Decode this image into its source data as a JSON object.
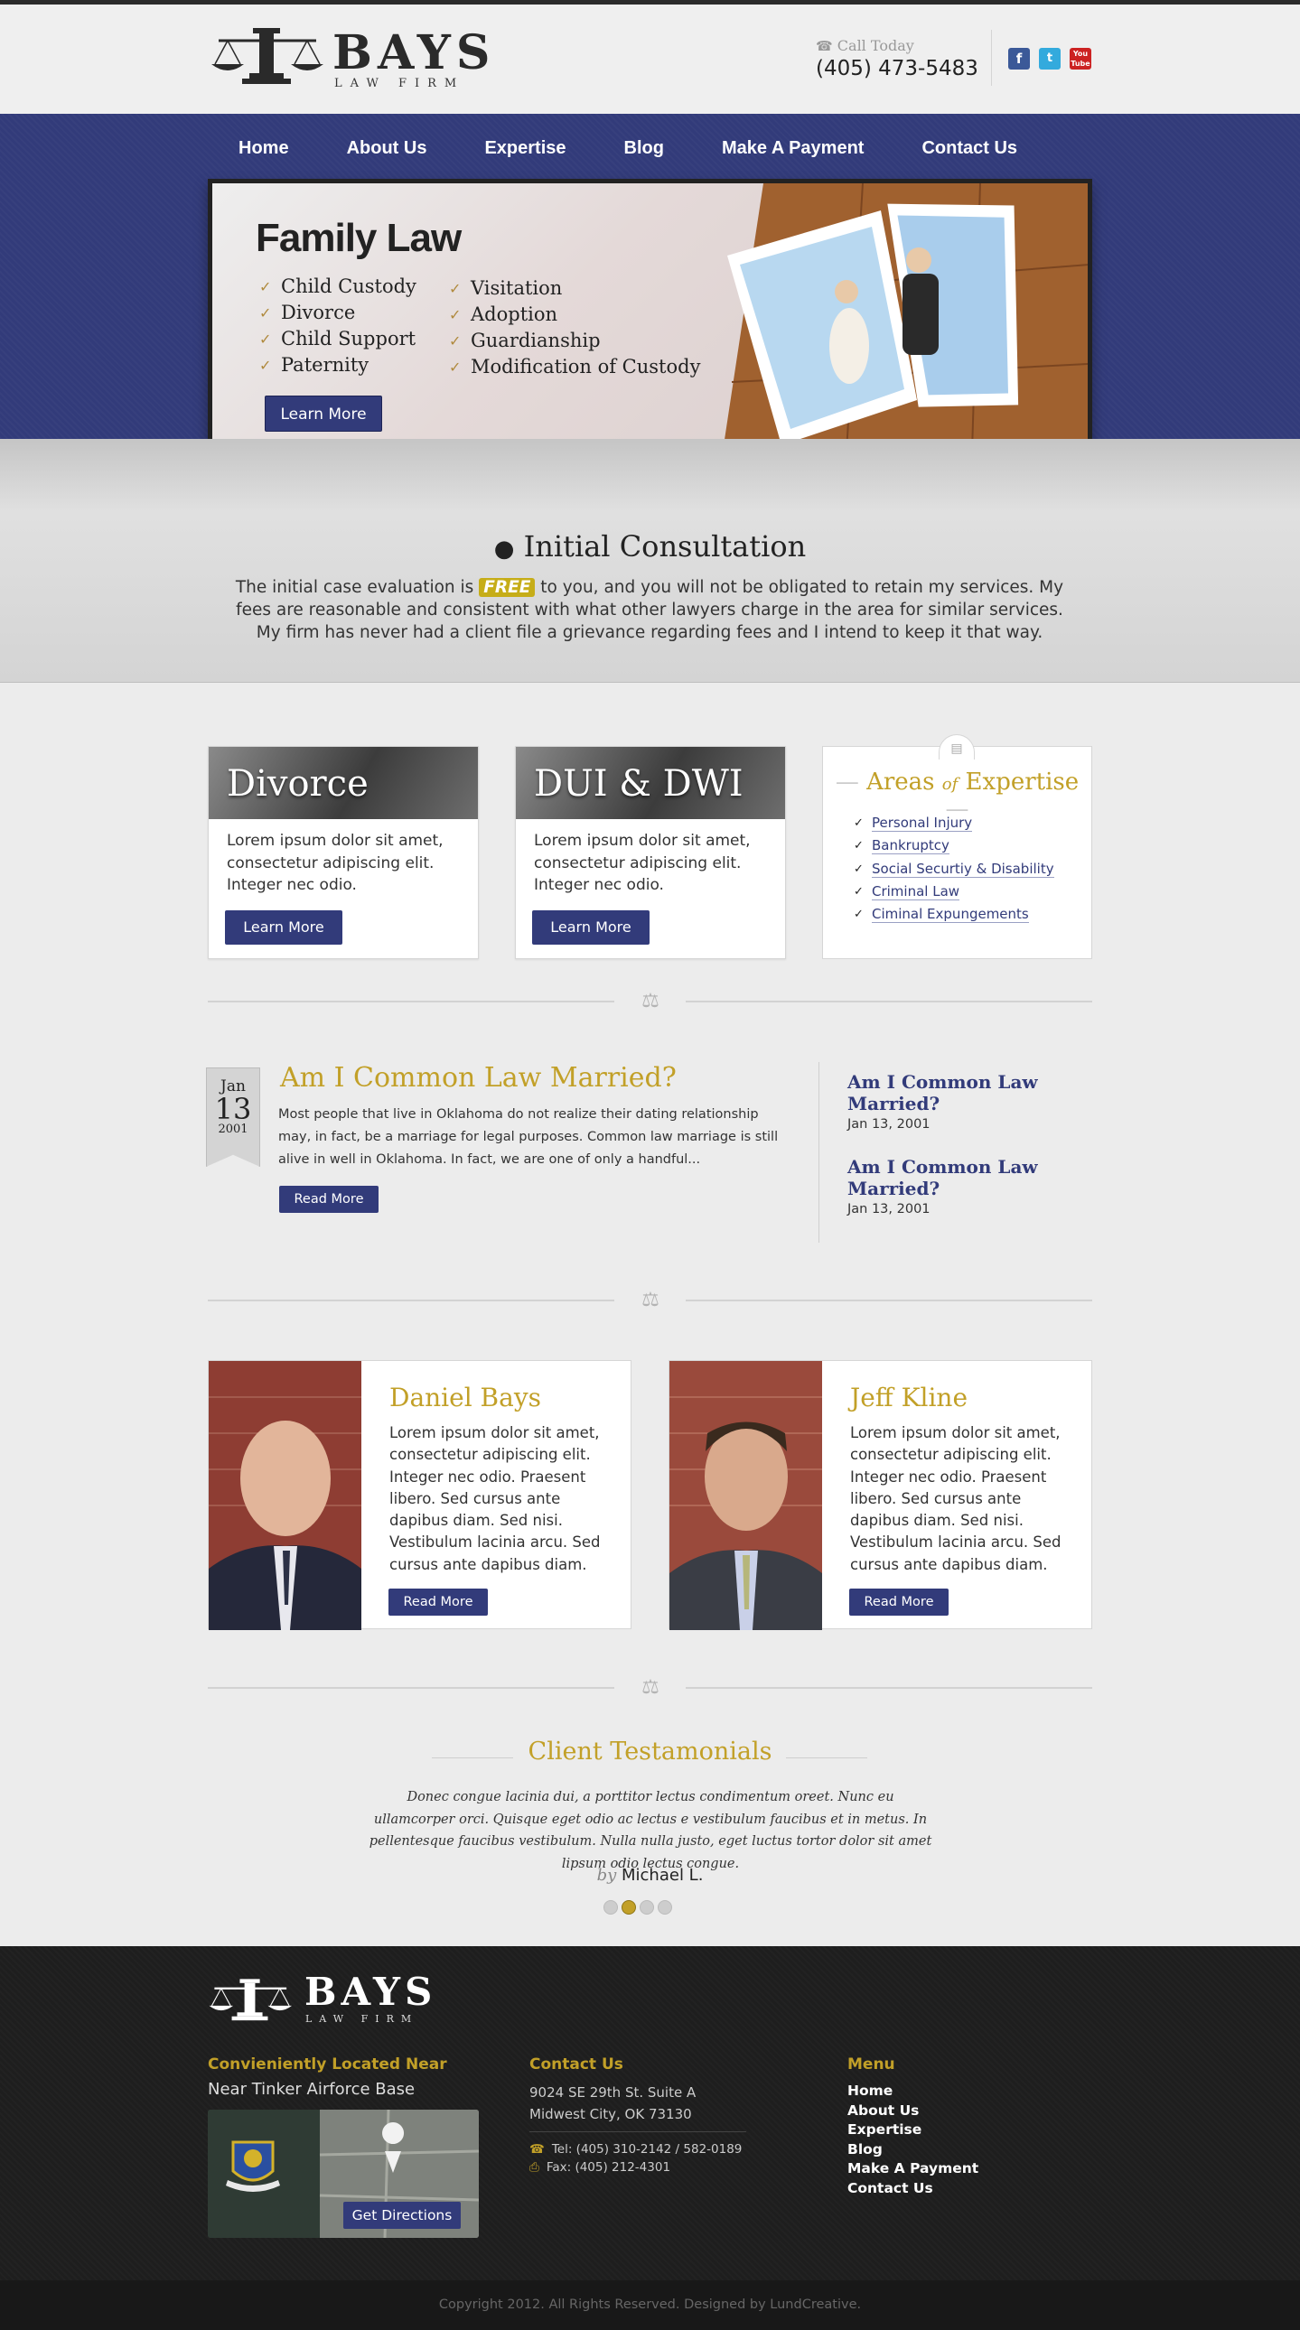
{
  "header": {
    "logo_name": "BAYS",
    "logo_sub": "LAW FIRM",
    "call_today": "Call Today",
    "phone": "(405) 473-5483",
    "social": [
      {
        "icon": "facebook-icon",
        "glyph": "f",
        "color": "#3b5998"
      },
      {
        "icon": "twitter-icon",
        "glyph": "t",
        "color": "#33aadd"
      },
      {
        "icon": "youtube-icon",
        "glyph": "You Tube",
        "color": "#cc2222"
      }
    ]
  },
  "nav": {
    "items": [
      "Home",
      "About Us",
      "Expertise",
      "Blog",
      "Make A Payment",
      "Contact Us"
    ]
  },
  "hero": {
    "title": "Family Law",
    "col1": [
      "Child Custody",
      "Divorce",
      "Child Support",
      "Paternity"
    ],
    "col2": [
      "Visitation",
      "Adoption",
      "Guardianship",
      "Modification of Custody"
    ],
    "button": "Learn More"
  },
  "consultation": {
    "title": "Initial Consultation",
    "text_before": "The initial case evaluation is ",
    "free": "FREE",
    "text_after": " to you, and you will not be obligated to retain my services.  My fees are reasonable and consistent with what other lawyers charge in the area for similar services. My firm has never had a client file a grievance regarding fees and I intend to keep it that way."
  },
  "services": [
    {
      "title": "Divorce",
      "text": "Lorem ipsum dolor sit amet, consectetur adipiscing elit. Integer nec odio.",
      "button": "Learn More"
    },
    {
      "title": "DUI & DWI",
      "text": "Lorem ipsum dolor sit amet, consectetur adipiscing elit. Integer nec odio.",
      "button": "Learn More"
    }
  ],
  "expertise": {
    "title_a": "Areas ",
    "title_of": "of",
    "title_b": " Expertise",
    "items": [
      "Personal Injury",
      "Bankruptcy",
      "Social Securtiy & Disability",
      "Criminal Law",
      "Ciminal Expungements"
    ]
  },
  "blog": {
    "month": "Jan",
    "day": "13",
    "year": "2001",
    "title": "Am I Common Law Married?",
    "excerpt": "Most people that live in Oklahoma do not realize their dating relationship may, in fact, be a marriage for legal purposes.  Common law marriage is still alive in well in Oklahoma.  In fact, we are one of only a handful...",
    "button": "Read More",
    "side": [
      {
        "title": "Am I Common Law Married?",
        "date": "Jan 13, 2001"
      },
      {
        "title": "Am I Common Law Married?",
        "date": "Jan 13, 2001"
      }
    ]
  },
  "team": [
    {
      "name": "Daniel Bays",
      "text": "Lorem ipsum dolor sit amet, consectetur adipiscing elit. Integer nec odio. Praesent libero. Sed cursus ante dapibus diam. Sed nisi. Vestibulum lacinia arcu. Sed cursus ante dapibus diam.",
      "button": "Read More"
    },
    {
      "name": "Jeff Kline",
      "text": "Lorem ipsum dolor sit amet, consectetur adipiscing elit. Integer nec odio. Praesent libero. Sed cursus ante dapibus diam. Sed nisi. Vestibulum lacinia arcu. Sed cursus ante dapibus diam.",
      "button": "Read More"
    }
  ],
  "testimonials": {
    "title": "Client Testamonials",
    "quote": "Donec congue lacinia dui, a porttitor lectus condimentum oreet. Nunc eu ullamcorper orci. Quisque eget odio ac lectus e vestibulum faucibus et in metus. In pellentesque faucibus vestibulum. Nulla nulla justo, eget luctus tortor dolor sit amet lipsum odio lectus congue.",
    "by": "by",
    "author": "Michael L.",
    "active_dot": 1
  },
  "footer": {
    "logo_name": "BAYS",
    "logo_sub": "LAW FIRM",
    "location_heading": "Convieniently Located Near",
    "location_sub": "Near Tinker Airforce Base",
    "directions_button": "Get Directions",
    "contact_heading": "Contact Us",
    "address_line1": "9024 SE 29th St. Suite A",
    "address_line2": "Midwest City, OK 73130",
    "tel": "Tel: (405) 310-2142 / 582-0189",
    "fax": "Fax: (405) 212-4301",
    "menu_heading": "Menu",
    "menu": [
      "Home",
      "About Us",
      "Expertise",
      "Blog",
      "Make A Payment",
      "Contact Us"
    ],
    "copyright": "Copyright 2012. All Rights Reserved. Designed by LundCreative."
  },
  "colors": {
    "navy": "#323b7a",
    "gold": "#c2a028",
    "footer": "#1e1e1e"
  }
}
